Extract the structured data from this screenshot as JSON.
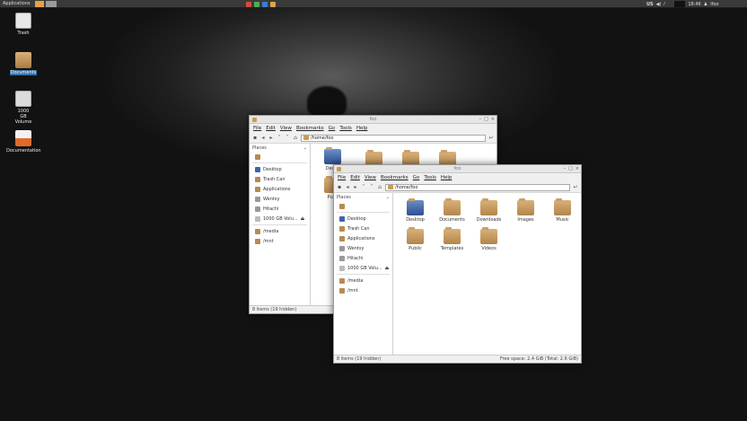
{
  "panel": {
    "apps_label": "Applications",
    "keyboard_layout": "US",
    "clock": "18:46",
    "user": "lfoo"
  },
  "desktop": {
    "icons": [
      {
        "label": "Trash"
      },
      {
        "label": "Documents"
      },
      {
        "label": "1000 GB Volume"
      },
      {
        "label": "Documentation"
      }
    ]
  },
  "back_window": {
    "title": "foo",
    "menus": [
      "File",
      "Edit",
      "View",
      "Bookmarks",
      "Go",
      "Tools",
      "Help"
    ],
    "path": "/home/foo",
    "places_header": "Places",
    "places": [
      "Desktop",
      "Trash Can",
      "Applications",
      "Wentsy",
      "Hitachi",
      "1000 GB Volu...",
      "/media",
      "/mnt"
    ],
    "files": [
      "Deskt",
      "Publ"
    ],
    "status": "8 items (19 hidden)"
  },
  "front_window": {
    "title": "foo",
    "menus": [
      "File",
      "Edit",
      "View",
      "Bookmarks",
      "Go",
      "Tools",
      "Help"
    ],
    "path": "/home/foo",
    "places_header": "Places",
    "places": [
      "Desktop",
      "Trash Can",
      "Applications",
      "Wentsy",
      "Hitachi",
      "1000 GB Volu...",
      "/media",
      "/mnt"
    ],
    "files": [
      "Desktop",
      "Documents",
      "Downloads",
      "Images",
      "Music",
      "Public",
      "Templates",
      "Videos"
    ],
    "status_left": "8 items (19 hidden)",
    "status_right": "Free space: 2.4 GiB (Total: 2.6 GiB)"
  }
}
